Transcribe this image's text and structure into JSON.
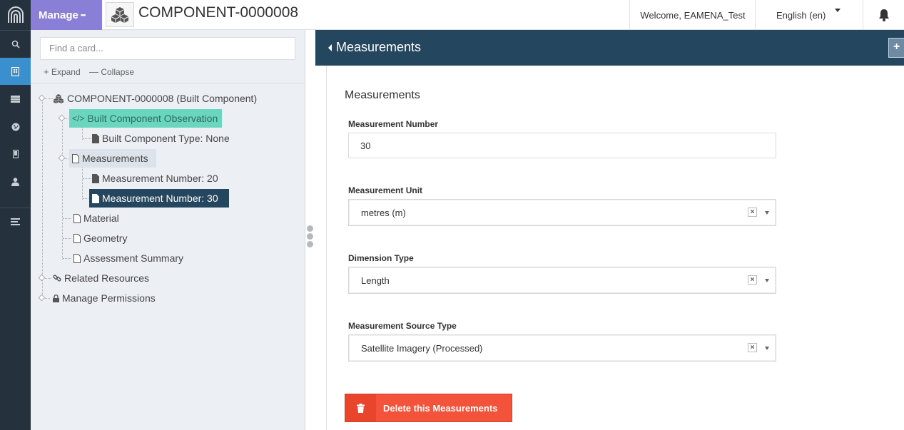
{
  "header": {
    "manage_label": "Manage",
    "manage_dots": "•••",
    "resource_title": "COMPONENT-0000008",
    "welcome": "Welcome, EAMENA_Test",
    "language": "English (en)"
  },
  "rail": {
    "icons": [
      "logo-icon",
      "search-icon",
      "resource-editor-icon",
      "database-icon",
      "globe-icon",
      "mobile-icon",
      "user-icon",
      "menu-icon"
    ],
    "active_color": "#3a8fcf"
  },
  "tree": {
    "search_placeholder": "Find a card...",
    "expand_label": "Expand",
    "collapse_label": "Collapse",
    "nodes": {
      "root": "COMPONENT-0000008 (Built Component)",
      "observation": "Built Component Observation",
      "component_type": "Built Component Type: None",
      "measurements": "Measurements",
      "meas_20": "Measurement Number: 20",
      "meas_30": "Measurement Number: 30",
      "material": "Material",
      "geometry": "Geometry",
      "assessment": "Assessment Summary",
      "related": "Related Resources",
      "permissions": "Manage Permissions"
    }
  },
  "main": {
    "header_title": "Measurements",
    "section_title": "Measurements",
    "fields": {
      "number_label": "Measurement Number",
      "number_value": "30",
      "unit_label": "Measurement Unit",
      "unit_value": "metres (m)",
      "dimension_label": "Dimension Type",
      "dimension_value": "Length",
      "source_label": "Measurement Source Type",
      "source_value": "Satellite Imagery (Processed)"
    },
    "delete_label": "Delete this Measurements"
  },
  "colors": {
    "rail": "#25323d",
    "manage": "#8a7fd6",
    "observation": "#6bd6be",
    "selected": "#25465f",
    "delete": "#f3533a"
  }
}
